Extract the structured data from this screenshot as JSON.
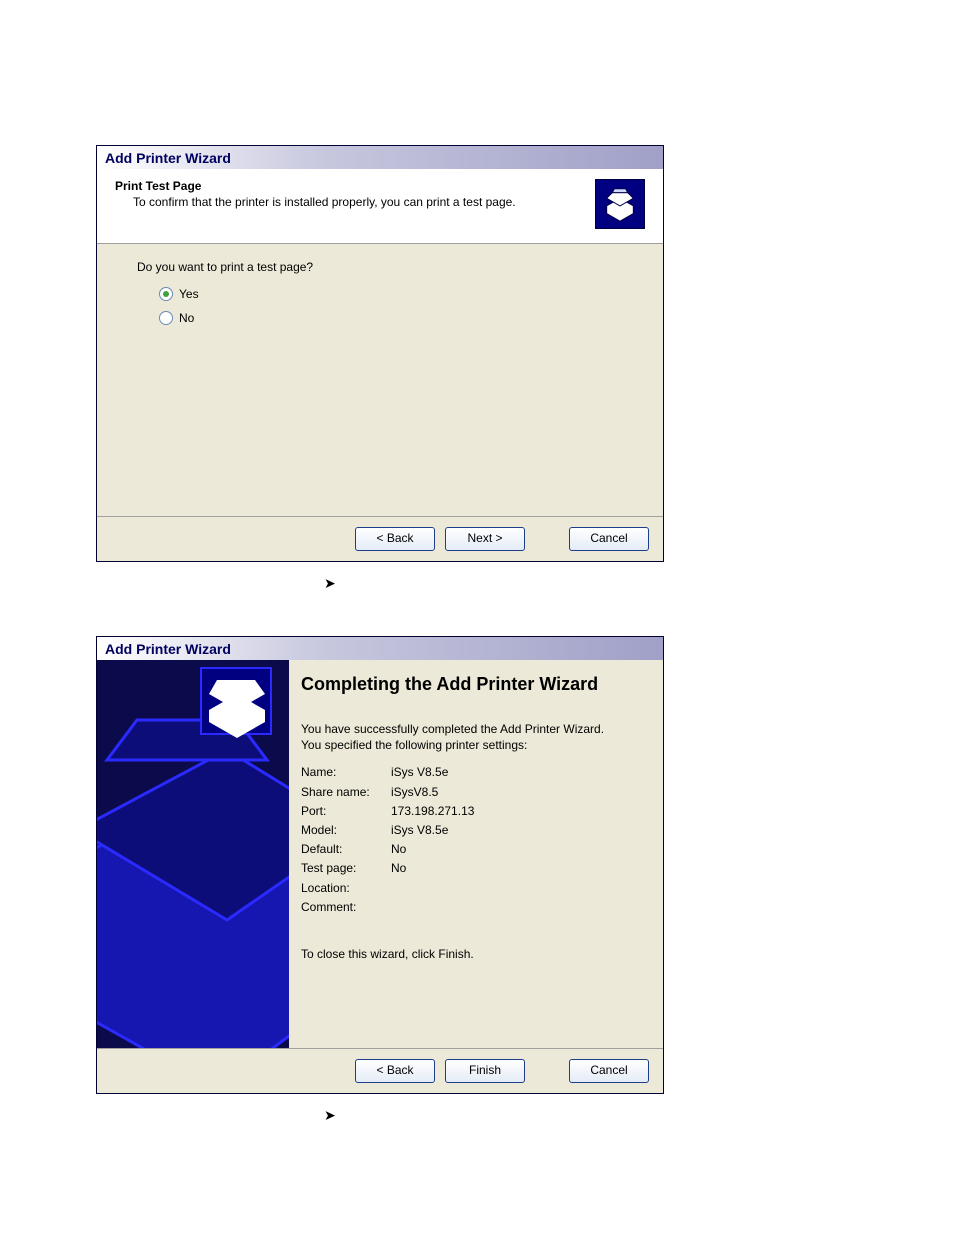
{
  "dialog1": {
    "title": "Add Printer Wizard",
    "header": {
      "heading": "Print Test Page",
      "sub": "To confirm that the printer is installed properly, you can print a test page."
    },
    "question": "Do you want to print a test page?",
    "options": {
      "yes": "Yes",
      "no": "No"
    },
    "buttons": {
      "back": "< Back",
      "next": "Next >",
      "cancel": "Cancel"
    }
  },
  "dialog2": {
    "title": "Add Printer Wizard",
    "heading": "Completing the Add Printer Wizard",
    "intro1": "You have successfully completed the Add Printer Wizard.",
    "intro2": "You specified the following printer settings:",
    "labels": {
      "name": "Name:",
      "share": "Share name:",
      "port": "Port:",
      "model": "Model:",
      "default": "Default:",
      "test": "Test page:",
      "location": "Location:",
      "comment": "Comment:"
    },
    "values": {
      "name": "iSys V8.5e",
      "share": "iSysV8.5",
      "port": "173.198.271.13",
      "model": "iSys V8.5e",
      "default": "No",
      "test": "No",
      "location": "",
      "comment": ""
    },
    "close_text": "To close this wizard, click Finish.",
    "buttons": {
      "back": "< Back",
      "finish": "Finish",
      "cancel": "Cancel"
    }
  },
  "arrow": "➤"
}
